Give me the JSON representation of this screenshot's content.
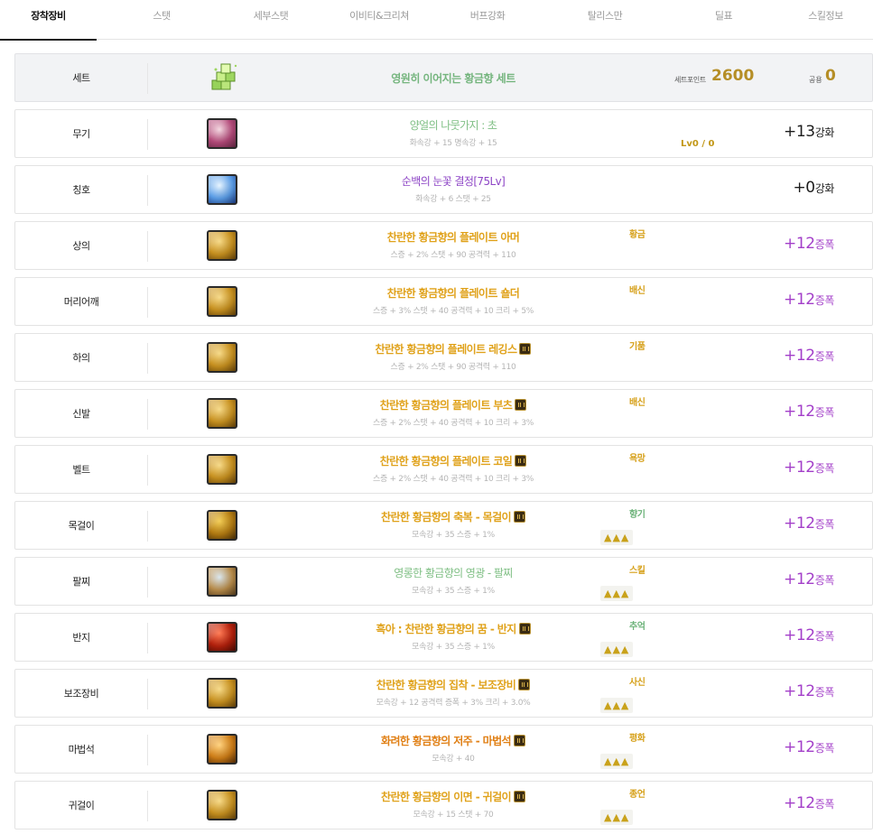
{
  "tabs": [
    {
      "label": "장착장비",
      "active": true
    },
    {
      "label": "스탯",
      "active": false
    },
    {
      "label": "세부스탯",
      "active": false
    },
    {
      "label": "이비티&크리쳐",
      "active": false
    },
    {
      "label": "버프강화",
      "active": false
    },
    {
      "label": "탈리스만",
      "active": false
    },
    {
      "label": "딜표",
      "active": false
    },
    {
      "label": "스킬정보",
      "active": false
    }
  ],
  "set": {
    "slot": "세트",
    "name": "영원히 이어지는 황금향 세트",
    "point_label": "세트포인트",
    "point_value": "2600",
    "common_label": "공용",
    "common_value": "0"
  },
  "equipment": [
    {
      "slot": "무기",
      "name": "양얼의 나뭇가지 : 초",
      "name_color": "#7fbf84",
      "name_bold": false,
      "badge": false,
      "stats": "화속강 + 15 명속강 + 15",
      "tag": "",
      "tag_class": "",
      "triangles": "",
      "extra": "Lv0 / 0",
      "enh_value": "+13",
      "enh_suffix": "강화",
      "enh_color": "dark",
      "icon_colors": [
        "#f3d7e0",
        "#b44a7a",
        "#6a2847"
      ]
    },
    {
      "slot": "칭호",
      "name": "순백의 눈꽃 결정[75Lv]",
      "name_color": "#8e46c6",
      "name_bold": false,
      "badge": false,
      "stats": "화속강 + 6 스탯 + 25",
      "tag": "",
      "tag_class": "",
      "triangles": "",
      "extra": "",
      "enh_value": "+0",
      "enh_suffix": "강화",
      "enh_color": "dark",
      "icon_colors": [
        "#e6f4ff",
        "#5b9ee8",
        "#1b3f8c"
      ]
    },
    {
      "slot": "상의",
      "name": "찬란한 황금향의 플레이트 아머",
      "name_color": "#e0a21b",
      "name_bold": true,
      "badge": false,
      "stats": "스증 + 2% 스탯 + 90 공격력 + 110",
      "tag": "황금",
      "tag_class": "gold",
      "triangles": "",
      "extra": "",
      "enh_value": "+12",
      "enh_suffix": "증폭",
      "enh_color": "purple",
      "icon_colors": [
        "#f6d987",
        "#c8911f",
        "#6b4608"
      ]
    },
    {
      "slot": "머리어깨",
      "name": "찬란한 황금향의 플레이트 숄더",
      "name_color": "#e0a21b",
      "name_bold": true,
      "badge": false,
      "stats": "스증 + 3% 스탯 + 40 공격력 + 10 크리 + 5%",
      "tag": "배신",
      "tag_class": "gold",
      "triangles": "",
      "extra": "",
      "enh_value": "+12",
      "enh_suffix": "증폭",
      "enh_color": "purple",
      "icon_colors": [
        "#f6d987",
        "#c8911f",
        "#6b4608"
      ]
    },
    {
      "slot": "하의",
      "name": "찬란한 황금향의 플레이트 레깅스",
      "name_color": "#e0a21b",
      "name_bold": true,
      "badge": true,
      "stats": "스증 + 2% 스탯 + 90 공격력 + 110",
      "tag": "기품",
      "tag_class": "gold",
      "triangles": "",
      "extra": "",
      "enh_value": "+12",
      "enh_suffix": "증폭",
      "enh_color": "purple",
      "icon_colors": [
        "#f6d987",
        "#c8911f",
        "#6b4608"
      ]
    },
    {
      "slot": "신발",
      "name": "찬란한 황금향의 플레이트 부츠",
      "name_color": "#e0a21b",
      "name_bold": true,
      "badge": true,
      "stats": "스증 + 2% 스탯 + 40 공격력 + 10 크리 + 3%",
      "tag": "배신",
      "tag_class": "gold",
      "triangles": "",
      "extra": "",
      "enh_value": "+12",
      "enh_suffix": "증폭",
      "enh_color": "purple",
      "icon_colors": [
        "#f6d987",
        "#c8911f",
        "#6b4608"
      ]
    },
    {
      "slot": "벨트",
      "name": "찬란한 황금향의 플레이트 코일",
      "name_color": "#e0a21b",
      "name_bold": true,
      "badge": true,
      "stats": "스증 + 2% 스탯 + 40 공격력 + 10 크리 + 3%",
      "tag": "욕망",
      "tag_class": "gold",
      "triangles": "",
      "extra": "",
      "enh_value": "+12",
      "enh_suffix": "증폭",
      "enh_color": "purple",
      "icon_colors": [
        "#f6d987",
        "#c8911f",
        "#6b4608"
      ]
    },
    {
      "slot": "목걸이",
      "name": "찬란한 황금향의 축복 - 목걸이",
      "name_color": "#e0a21b",
      "name_bold": true,
      "badge": true,
      "stats": "모속강 + 35 스증 + 1%",
      "tag": "향기",
      "tag_class": "green",
      "triangles": "▲▲▲",
      "extra": "",
      "enh_value": "+12",
      "enh_suffix": "증폭",
      "enh_color": "purple",
      "icon_colors": [
        "#f2cc55",
        "#b47c12",
        "#4e3105"
      ]
    },
    {
      "slot": "팔찌",
      "name": "영롱한 황금향의 영광 - 팔찌",
      "name_color": "#7fbf84",
      "name_bold": false,
      "badge": false,
      "stats": "모속강 + 35 스증 + 1%",
      "tag": "스킬",
      "tag_class": "gold",
      "triangles": "▲▲▲",
      "extra": "",
      "enh_value": "+12",
      "enh_suffix": "증폭",
      "enh_color": "purple",
      "icon_colors": [
        "#d9e6ee",
        "#b88c4a",
        "#5a3f1d"
      ]
    },
    {
      "slot": "반지",
      "name": "흑아 : 찬란한 황금향의 꿈 - 반지",
      "name_color": "#e0a21b",
      "name_bold": true,
      "badge": true,
      "stats": "모속강 + 35 스증 + 1%",
      "tag": "추억",
      "tag_class": "green",
      "triangles": "▲▲▲",
      "extra": "",
      "enh_value": "+12",
      "enh_suffix": "증폭",
      "enh_color": "purple",
      "icon_colors": [
        "#ff7a54",
        "#b3200c",
        "#4d0a02"
      ]
    },
    {
      "slot": "보조장비",
      "name": "찬란한 황금향의 집착 - 보조장비",
      "name_color": "#e0a21b",
      "name_bold": true,
      "badge": true,
      "stats": "모속강 + 12 공격력 증폭 + 3% 크리 + 3.0%",
      "tag": "사신",
      "tag_class": "gold",
      "triangles": "▲▲▲",
      "extra": "",
      "enh_value": "+12",
      "enh_suffix": "증폭",
      "enh_color": "purple",
      "icon_colors": [
        "#f6d987",
        "#c8911f",
        "#6b4608"
      ]
    },
    {
      "slot": "마법석",
      "name": "화려한 황금향의 저주 - 마법석",
      "name_color": "#e07f14",
      "name_bold": true,
      "badge": true,
      "stats": "모속강 + 40",
      "tag": "평화",
      "tag_class": "gold",
      "triangles": "▲▲▲",
      "extra": "",
      "enh_value": "+12",
      "enh_suffix": "증폭",
      "enh_color": "purple",
      "icon_colors": [
        "#ffd27e",
        "#cf7e17",
        "#5b2f05"
      ]
    },
    {
      "slot": "귀걸이",
      "name": "찬란한 황금향의 이면 - 귀걸이",
      "name_color": "#e0a21b",
      "name_bold": true,
      "badge": true,
      "stats": "모속강 + 15 스탯 + 70",
      "tag": "종언",
      "tag_class": "gold",
      "triangles": "▲▲▲",
      "extra": "",
      "enh_value": "+12",
      "enh_suffix": "증폭",
      "enh_color": "purple",
      "icon_colors": [
        "#f6d987",
        "#c8911f",
        "#6b4608"
      ]
    }
  ]
}
